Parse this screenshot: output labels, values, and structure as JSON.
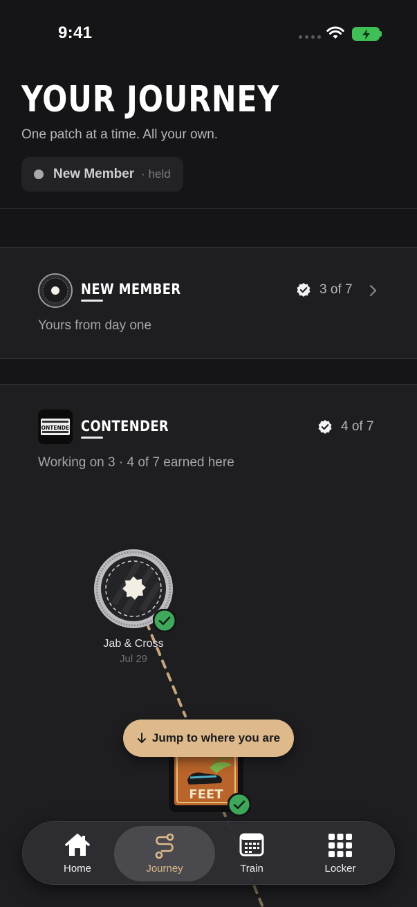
{
  "status_bar": {
    "time": "9:41"
  },
  "header": {
    "title": "YOUR JOURNEY",
    "subtitle": "One patch at a time. All your own.",
    "rank_pill": {
      "name": "New Member",
      "status": "· held"
    }
  },
  "ranks": [
    {
      "title": "NEW MEMBER",
      "subtitle": "Yours from day one",
      "count": "3 of 7",
      "badge_icon": "new-member-patch-icon"
    },
    {
      "title": "CONTENDER",
      "subtitle": "Working on 3 · 4 of 7 earned here",
      "count": "4 of 7",
      "badge_icon": "contender-patch-icon",
      "badge_text": "CONTENDER"
    }
  ],
  "journey": {
    "nodes": [
      {
        "label": "Jab & Cross",
        "date": "Jul 29",
        "earned": true
      },
      {
        "label": "",
        "patch_text": "FEET",
        "earned": true
      }
    ],
    "jump_button": "Jump to where you are"
  },
  "tab_bar": {
    "tabs": [
      {
        "label": "Home",
        "icon": "home-icon",
        "active": false
      },
      {
        "label": "Journey",
        "icon": "journey-path-icon",
        "active": true
      },
      {
        "label": "Train",
        "icon": "calendar-icon",
        "active": false
      },
      {
        "label": "Locker",
        "icon": "grid-icon",
        "active": false
      }
    ]
  },
  "colors": {
    "accent": "#ddb98c",
    "earned_check": "#3fa85a",
    "background": "#151517",
    "card": "#1e1e21"
  }
}
